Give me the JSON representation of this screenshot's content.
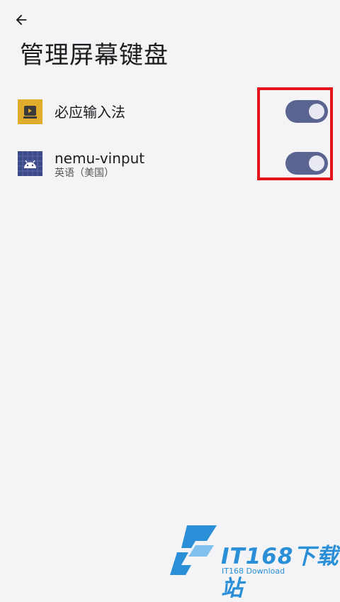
{
  "header": {
    "title": "管理屏幕键盘"
  },
  "keyboards": [
    {
      "name": "必应输入法",
      "subtitle": "",
      "icon": "bing-keyboard-icon",
      "enabled": true
    },
    {
      "name": "nemu-vinput",
      "subtitle": "英语（美国）",
      "icon": "android-icon",
      "enabled": true
    }
  ],
  "colors": {
    "toggle_track": "#5a6491",
    "toggle_knob": "#e8e9f3",
    "highlight": "#e5141b",
    "background": "#f4f4f7"
  },
  "watermark": {
    "brand": "IT168下载站",
    "sub": "IT168 Download"
  }
}
